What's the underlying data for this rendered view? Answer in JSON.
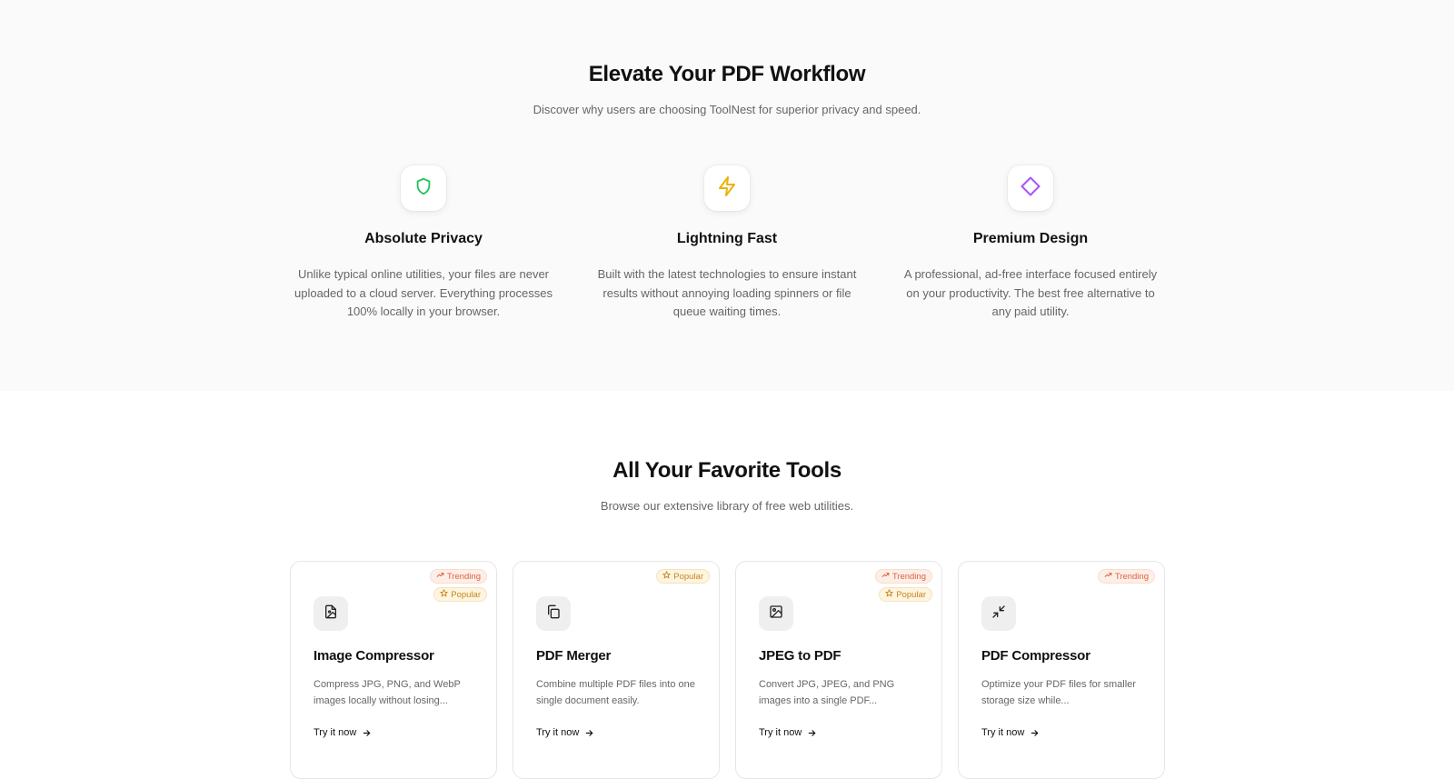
{
  "features_section": {
    "title": "Elevate Your PDF Workflow",
    "subtitle": "Discover why users are choosing ToolNest for superior privacy and speed.",
    "features": [
      {
        "title": "Absolute Privacy",
        "description": "Unlike typical online utilities, your files are never uploaded to a cloud server. Everything processes 100% locally in your browser.",
        "icon": "shield-icon",
        "icon_color": "#22c55e"
      },
      {
        "title": "Lightning Fast",
        "description": "Built with the latest technologies to ensure instant results without annoying loading spinners or file queue waiting times.",
        "icon": "lightning-icon",
        "icon_color": "#eab308"
      },
      {
        "title": "Premium Design",
        "description": "A professional, ad-free interface focused entirely on your productivity. The best free alternative to any paid utility.",
        "icon": "diamond-icon",
        "icon_color": "#a855f7"
      }
    ]
  },
  "tools_section": {
    "title": "All Your Favorite Tools",
    "subtitle": "Browse our extensive library of free web utilities.",
    "cta_label": "Try it now",
    "badge_labels": {
      "trending": "Trending",
      "popular": "Popular"
    },
    "tools": [
      {
        "title": "Image Compressor",
        "description": "Compress JPG, PNG, and WebP images locally without losing...",
        "icon": "image-file-icon",
        "badges": [
          "Trending",
          "Popular"
        ]
      },
      {
        "title": "PDF Merger",
        "description": "Combine multiple PDF files into one single document easily.",
        "icon": "copy-files-icon",
        "badges": [
          "Popular"
        ]
      },
      {
        "title": "JPEG to PDF",
        "description": "Convert JPG, JPEG, and PNG images into a single PDF...",
        "icon": "image-icon",
        "badges": [
          "Trending",
          "Popular"
        ]
      },
      {
        "title": "PDF Compressor",
        "description": "Optimize your PDF files for smaller storage size while...",
        "icon": "minimize-icon",
        "badges": [
          "Trending"
        ]
      }
    ]
  },
  "colors": {
    "page_bg_features": "#fafafa",
    "page_bg_tools": "#ffffff",
    "heading": "#111111",
    "body_text": "#666666",
    "trending_badge": "#e0623a",
    "popular_badge": "#c9861a"
  }
}
